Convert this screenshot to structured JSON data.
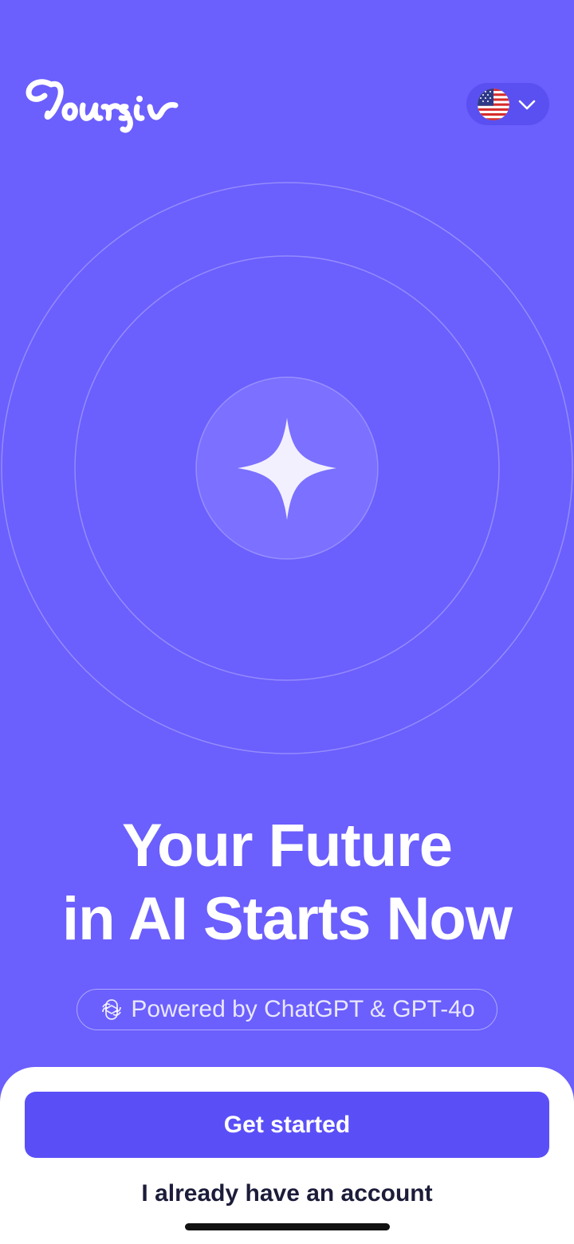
{
  "app": {
    "logo_text": "Coursiv",
    "accent_color": "#6b5ffd",
    "button_color": "#5a4ff7"
  },
  "language_selector": {
    "flag_icon": "us-flag-icon",
    "dropdown_icon": "chevron-down-icon"
  },
  "hero": {
    "center_icon": "sparkle-star-icon",
    "headline_line1": "Your Future",
    "headline_line2": "in AI Starts Now"
  },
  "powered_by": {
    "icon": "openai-logo-icon",
    "text": "Powered by ChatGPT & GPT-4o"
  },
  "actions": {
    "primary_label": "Get started",
    "secondary_label": "I already have an account"
  }
}
